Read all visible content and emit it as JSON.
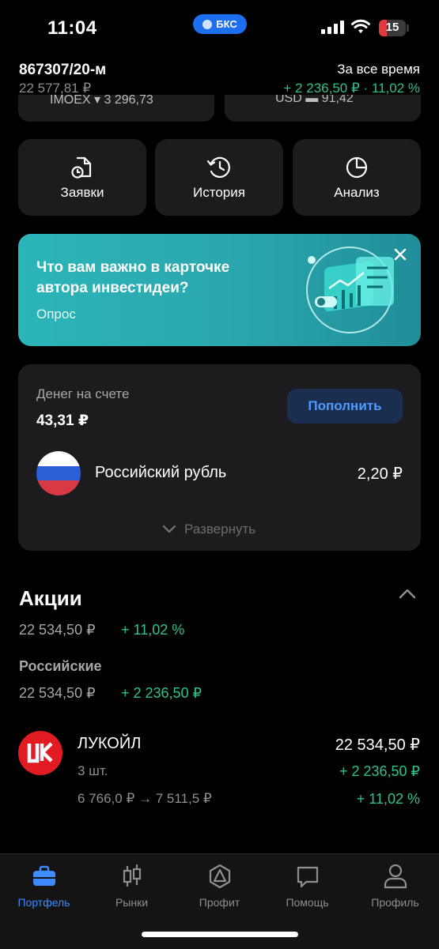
{
  "status": {
    "time": "11:04",
    "carrier_pill": "БКС",
    "battery": "15"
  },
  "account": {
    "name": "867307/20-м",
    "total": "22 577,81 ₽",
    "period": "За все время",
    "period_gain": "+ 2 236,50 ₽ · 11,02 %"
  },
  "tickers": [
    {
      "text": "IMOEX ▾ 3 296,73"
    },
    {
      "text": "USD ▬ 91,42"
    }
  ],
  "actions": [
    {
      "label": "Заявки",
      "icon": "orders-icon"
    },
    {
      "label": "История",
      "icon": "history-icon"
    },
    {
      "label": "Анализ",
      "icon": "pie-chart-icon"
    }
  ],
  "promo": {
    "title": "Что вам важно в карточке автора инвестидеи?",
    "link": "Опрос"
  },
  "money": {
    "label": "Денег на счете",
    "value": "43,31 ₽",
    "topup": "Пополнить",
    "currency_name": "Российский рубль",
    "currency_value": "2,20 ₽",
    "expand": "Развернуть"
  },
  "stocks": {
    "title": "Акции",
    "sum": "22 534,50 ₽",
    "pct": "+ 11,02 %",
    "subsection": "Российские",
    "sub_sum": "22 534,50 ₽",
    "sub_gain": "+ 2 236,50 ₽",
    "item": {
      "name": "ЛУКОЙЛ",
      "qty": "3 шт.",
      "price_change": "6 766,0 ₽ → 7 511,5 ₽",
      "value": "22 534,50 ₽",
      "gain": "+ 2 236,50 ₽",
      "pct": "+ 11,02 %"
    }
  },
  "tabs": [
    {
      "label": "Портфель",
      "active": true
    },
    {
      "label": "Рынки"
    },
    {
      "label": "Профит"
    },
    {
      "label": "Помощь"
    },
    {
      "label": "Профиль"
    }
  ],
  "colors": {
    "accent": "#3d8bff",
    "gain": "#2fc28c",
    "promo": "#2bb5b8",
    "card": "#1c1c1e"
  }
}
